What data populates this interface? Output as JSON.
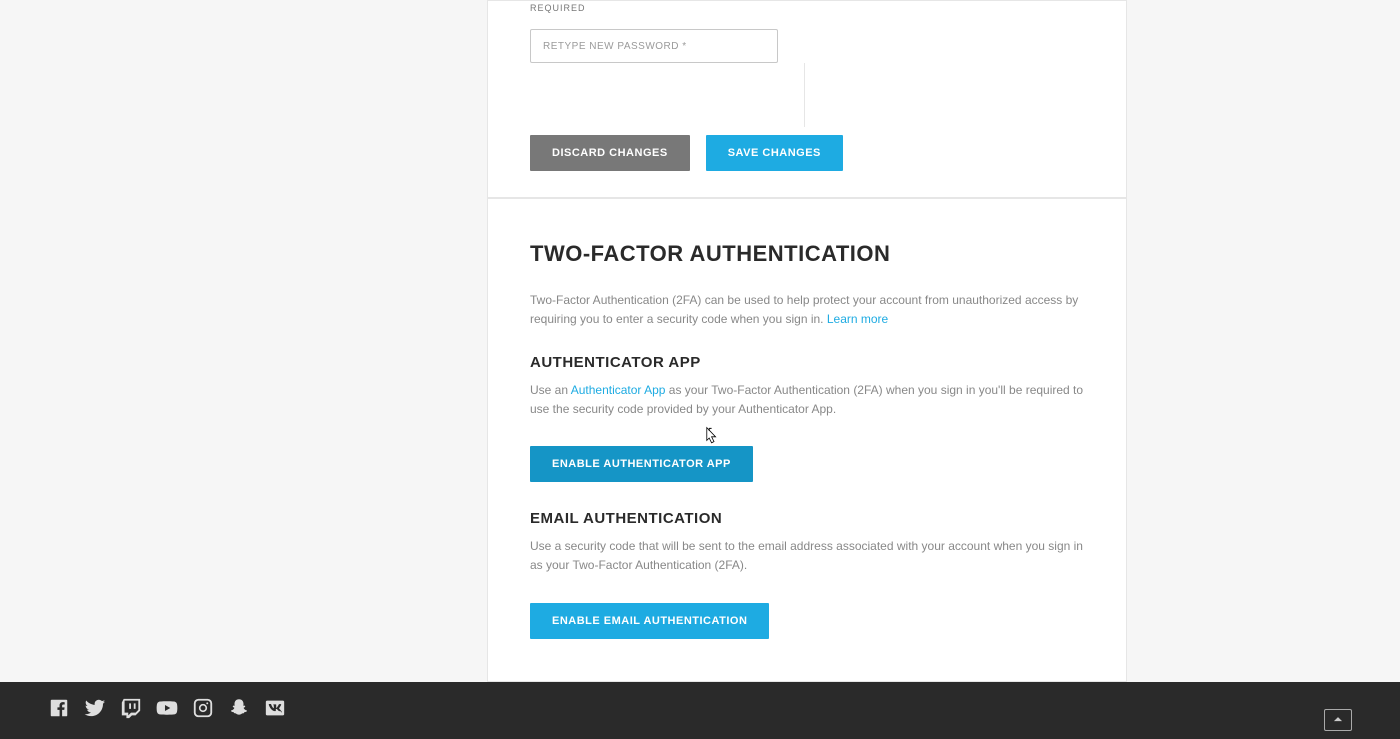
{
  "password": {
    "required_label": "REQUIRED",
    "retype_placeholder": "RETYPE NEW PASSWORD *",
    "discard_label": "DISCARD CHANGES",
    "save_label": "SAVE CHANGES"
  },
  "tfa": {
    "heading": "TWO-FACTOR AUTHENTICATION",
    "desc_prefix": "Two-Factor Authentication (2FA) can be used to help protect your account from unauthorized access by requiring you to enter a security code when you sign in. ",
    "learn_more": "Learn more",
    "auth_app": {
      "heading": "AUTHENTICATOR APP",
      "desc_prefix": "Use an ",
      "desc_link": "Authenticator App",
      "desc_suffix": " as your Two-Factor Authentication (2FA) when you sign in you'll be required to use the security code provided by your Authenticator App.",
      "button": "ENABLE AUTHENTICATOR APP"
    },
    "email_auth": {
      "heading": "EMAIL AUTHENTICATION",
      "desc": "Use a security code that will be sent to the email address associated with your account when you sign in as your Two-Factor Authentication (2FA).",
      "button": "ENABLE EMAIL AUTHENTICATION"
    }
  },
  "footer": {
    "social": [
      "facebook",
      "twitter",
      "twitch",
      "youtube",
      "instagram",
      "snapchat",
      "vk"
    ]
  }
}
